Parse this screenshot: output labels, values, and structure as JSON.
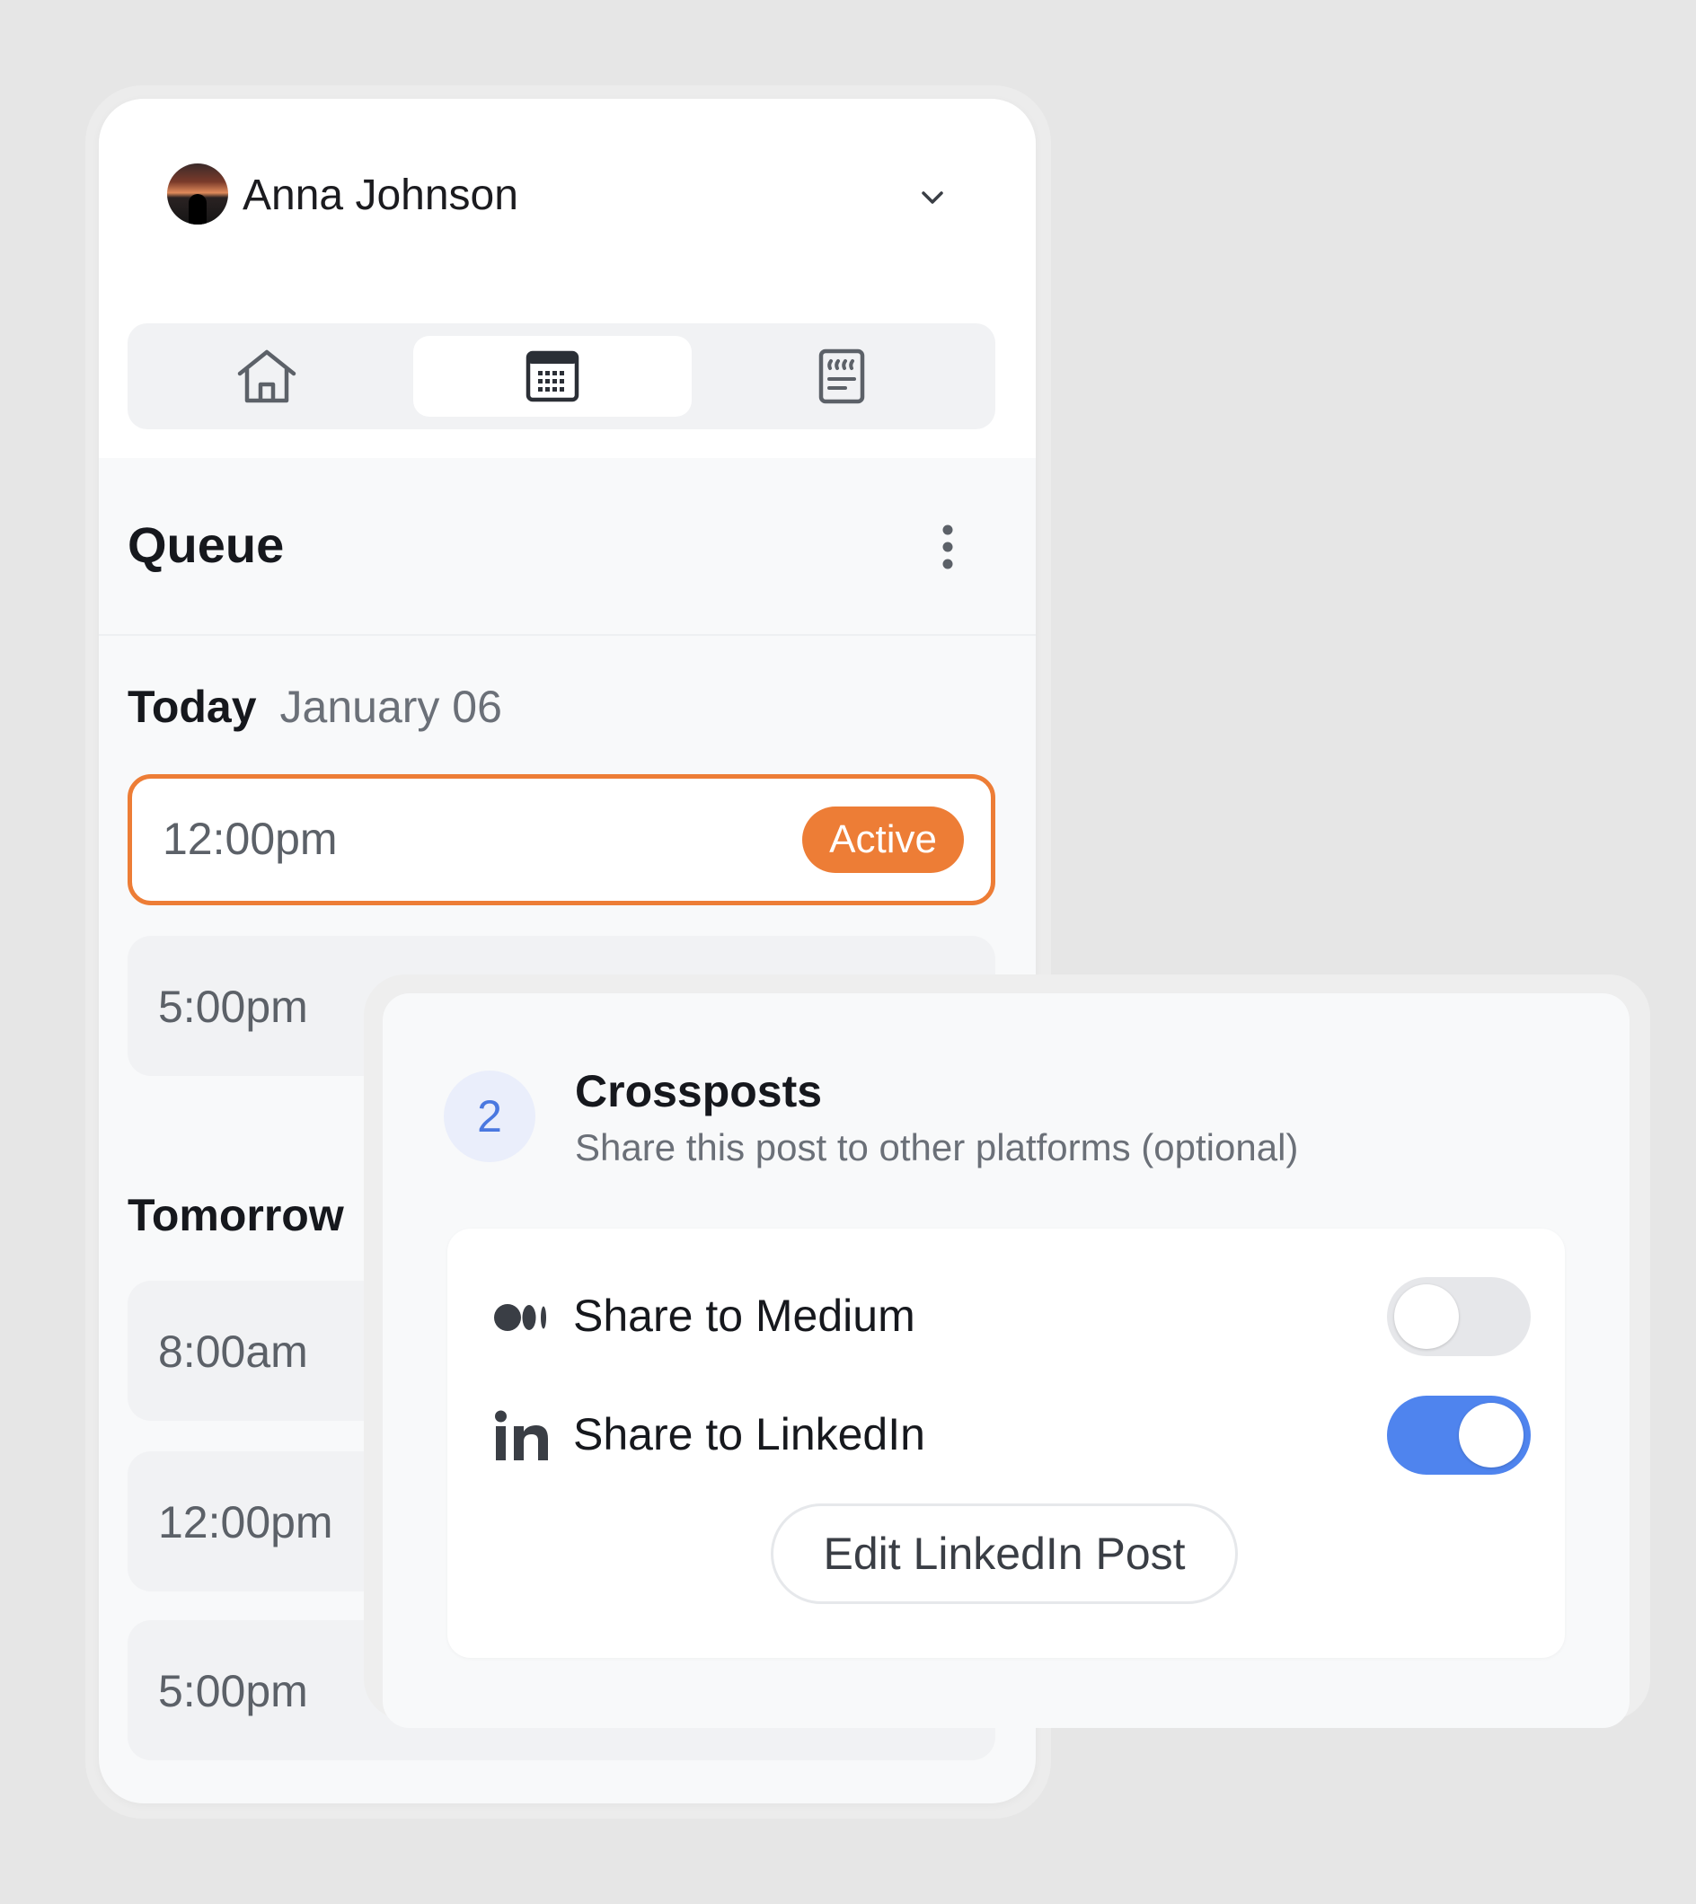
{
  "user": {
    "name": "Anna Johnson",
    "avatar_icon": "avatar-photo",
    "menu_icon": "chevron-down-icon"
  },
  "nav_tabs": [
    {
      "icon": "home-icon",
      "active": false
    },
    {
      "icon": "calendar-icon",
      "active": true
    },
    {
      "icon": "quote-document-icon",
      "active": false
    }
  ],
  "queue": {
    "title": "Queue",
    "menu_icon": "more-vertical-icon",
    "today": {
      "label": "Today",
      "date": "January 06",
      "slots": [
        {
          "time": "12:00pm",
          "status": "Active"
        },
        {
          "time": "5:00pm"
        }
      ]
    },
    "tomorrow": {
      "label": "Tomorrow",
      "slots": [
        {
          "time": "8:00am"
        },
        {
          "time": "12:00pm"
        },
        {
          "time": "5:00pm"
        }
      ]
    }
  },
  "crossposts": {
    "step": "2",
    "title": "Crossposts",
    "subtitle": "Share this post to other platforms (optional)",
    "options": [
      {
        "icon": "medium-icon",
        "label": "Share to Medium",
        "enabled": false
      },
      {
        "icon": "linkedin-icon",
        "label": "Share to LinkedIn",
        "enabled": true
      }
    ],
    "edit_button": "Edit LinkedIn Post"
  },
  "colors": {
    "accent_orange": "#ed7d36",
    "toggle_on_blue": "#4f84ee",
    "step_blue": "#4a78e0",
    "background": "#e6e6e6"
  }
}
